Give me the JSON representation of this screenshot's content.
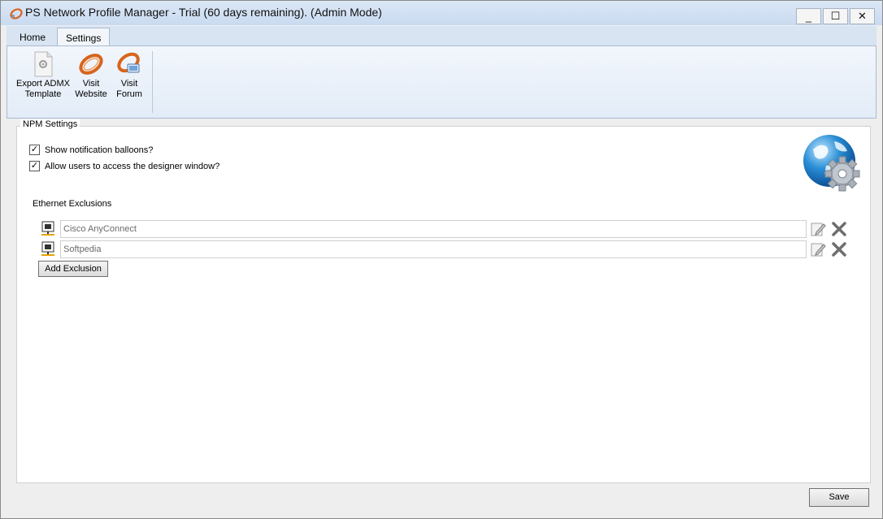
{
  "window": {
    "title": "PS Network Profile Manager - Trial (60 days remaining). (Admin Mode)",
    "minimize": "_",
    "maximize": "☐",
    "close": "✕"
  },
  "ribbon": {
    "tabs": [
      {
        "label": "Home",
        "active": false
      },
      {
        "label": "Settings",
        "active": true
      }
    ],
    "buttons": [
      {
        "line1": "Export ADMX",
        "line2": "Template",
        "icon": "document-gear-icon"
      },
      {
        "line1": "Visit",
        "line2": "Website",
        "icon": "globe-ring-icon"
      },
      {
        "line1": "Visit",
        "line2": "Forum",
        "icon": "forum-ring-icon"
      }
    ]
  },
  "settings": {
    "group_title": "NPM Settings",
    "checkboxes": [
      {
        "label": "Show notification balloons?",
        "checked": true
      },
      {
        "label": "Allow users to access the designer window?",
        "checked": true
      }
    ],
    "exclusions_label": "Ethernet Exclusions",
    "exclusions": [
      {
        "value": "Cisco AnyConnect"
      },
      {
        "value": "Softpedia"
      }
    ],
    "add_button": "Add Exclusion"
  },
  "footer": {
    "save_button": "Save"
  },
  "colors": {
    "title_bar": "#c9daf0",
    "ribbon_bg": "#e3ecf7",
    "accent_orange": "#d8641c",
    "globe_blue": "#2b8fd6"
  }
}
